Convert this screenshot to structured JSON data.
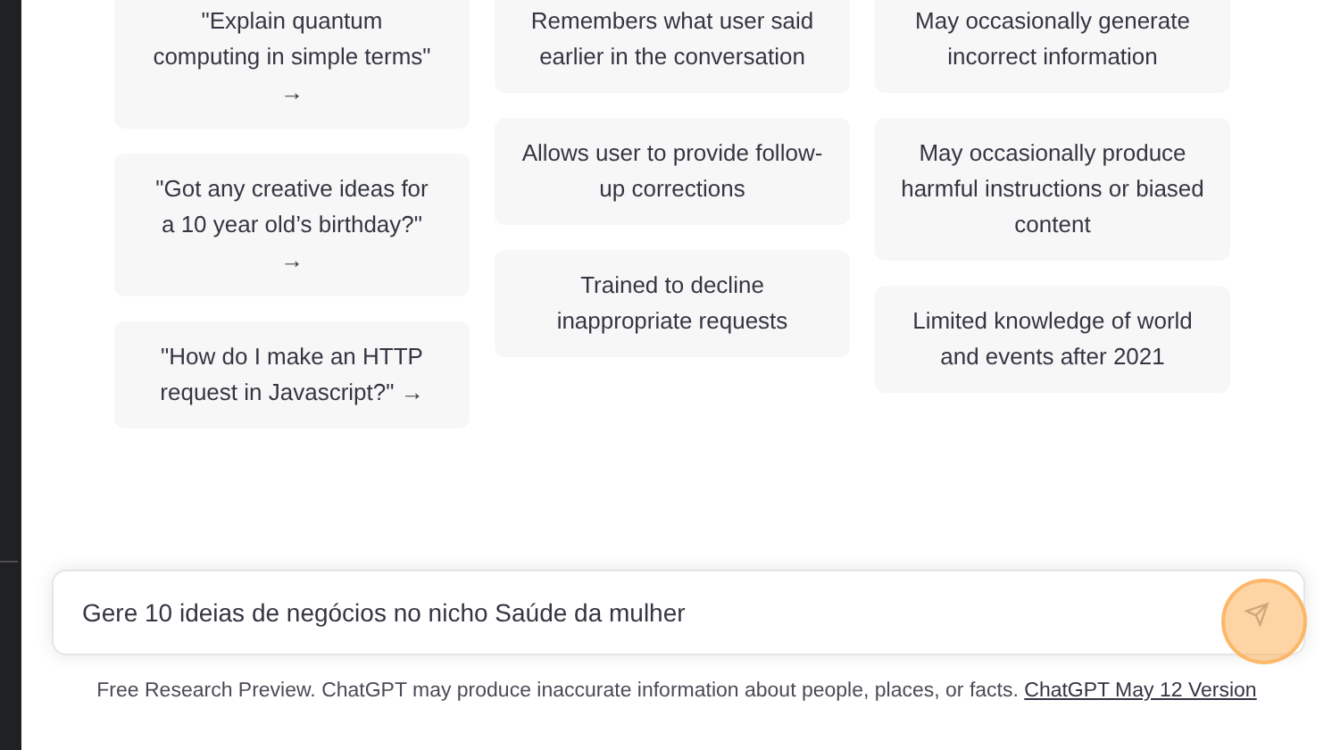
{
  "examples": [
    "\"Explain quantum computing in simple terms\" →",
    "\"Got any creative ideas for a 10 year old’s birthday?\" →",
    "\"How do I make an HTTP request in Javascript?\" →"
  ],
  "capabilities": [
    "Remembers what user said earlier in the conversation",
    "Allows user to provide follow-up corrections",
    "Trained to decline inappropriate requests"
  ],
  "limitations": [
    "May occasionally generate incorrect information",
    "May occasionally produce harmful instructions or biased content",
    "Limited knowledge of world and events after 2021"
  ],
  "prompt": {
    "value": "Gere 10 ideias de negócios no nicho Saúde da mulher",
    "cursor_highlight": true
  },
  "footer": {
    "text": "Free Research Preview. ChatGPT may produce inaccurate information about people, places, or facts.",
    "link": "ChatGPT May 12 Version"
  }
}
